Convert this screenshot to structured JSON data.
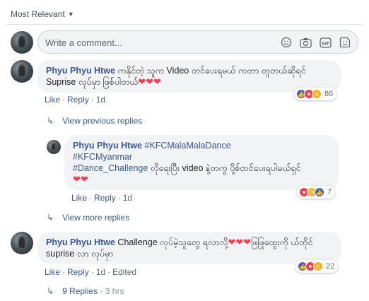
{
  "sort": {
    "label": "Most Relevant"
  },
  "composer": {
    "placeholder": "Write a comment..."
  },
  "comments": [
    {
      "author": "Phyu Phyu Htwe",
      "text": "ကနိုင်တဲ့ သူက Video တင်ပေးရမယ် ကတာ တူတယ်ဆိုရင် Suprise လုပ်မှာ ဖြစ်ပါတယ်",
      "hearts": "❤❤❤",
      "like": "Like",
      "reply": "Reply",
      "time": "1d",
      "reaction_count": "86"
    },
    {
      "author": "Phyu Phyu Htwe",
      "tag1": "#KFCMalaMalaDance",
      "tag2": "#KFCMyanmar",
      "tag3": "#Dance_Challenge",
      "text": " လိုရေးပြီး video နဲ့တကွ ပို့စ်တင်ပေးရပါမယ်ရှင်",
      "hearts": "❤❤",
      "like": "Like",
      "reply": "Reply",
      "time": "1d",
      "reaction_count": "7"
    },
    {
      "author": "Phyu Phyu Htwe",
      "text_a": " Challenge လုပ်မဲ့သူတွေ ရလာလို့",
      "hearts": "❤❤❤",
      "text_b": "ဖြဖြုထွေးကို ယ်တိုင် suprise လာ လုပ်မှာ",
      "like": "Like",
      "reply": "Reply",
      "time": "1d",
      "edited": "Edited",
      "reaction_count": "22"
    }
  ],
  "replies": {
    "view_previous": "View previous replies",
    "view_more": "View more replies",
    "nine_replies": "9 Replies",
    "nine_replies_time": "3 hrs"
  },
  "colors": {
    "link": "#385898",
    "bubble": "#f2f3f5",
    "love": "#f33e58",
    "like": "#4267b2"
  }
}
